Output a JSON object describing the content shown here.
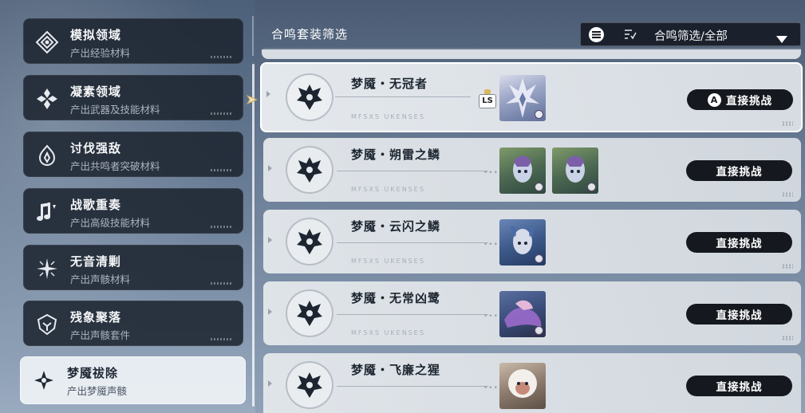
{
  "sidebar": {
    "items": [
      {
        "title": "模拟领域",
        "subtitle": "产出经验材料",
        "icon": "diamond-grid-icon",
        "active": false
      },
      {
        "title": "凝素领域",
        "subtitle": "产出武器及技能材料",
        "icon": "crystal-cluster-icon",
        "active": false
      },
      {
        "title": "讨伐强敌",
        "subtitle": "产出共鸣者突破材料",
        "icon": "flame-crest-icon",
        "active": false
      },
      {
        "title": "战歌重奏",
        "subtitle": "产出高级技能材料",
        "icon": "music-note-icon",
        "active": false
      },
      {
        "title": "无音清剿",
        "subtitle": "产出声骸材料",
        "icon": "starburst-icon",
        "active": false
      },
      {
        "title": "残象聚落",
        "subtitle": "产出声骸套件",
        "icon": "mask-crest-icon",
        "active": false
      },
      {
        "title": "梦魇祓除",
        "subtitle": "产出梦魇声骸",
        "icon": "nightmare-star-icon",
        "active": true
      }
    ]
  },
  "header": {
    "title": "合鸣套装筛选",
    "filter_label": "合鸣筛选/全部"
  },
  "rows": [
    {
      "name": "梦魇・无冠者",
      "sub": "MFSXS UKENSES",
      "button": "直接挑战",
      "button_key": "A",
      "selected": true,
      "portraits": 1,
      "ls_badge": "LS"
    },
    {
      "name": "梦魇・朔雷之鳞",
      "sub": "MFSXS UKENSES",
      "button": "直接挑战",
      "selected": false,
      "portraits": 2
    },
    {
      "name": "梦魇・云闪之鳞",
      "sub": "MFSXS UKENSES",
      "button": "直接挑战",
      "selected": false,
      "portraits": 1
    },
    {
      "name": "梦魇・无常凶鹭",
      "sub": "MFSXS UKENSES",
      "button": "直接挑战",
      "selected": false,
      "portraits": 1
    },
    {
      "name": "梦魇・飞廉之猩",
      "sub": "MFSXS UKENSES",
      "button": "直接挑战",
      "selected": false,
      "portraits": 1
    }
  ],
  "colors": {
    "panel_dark": "#1c2430",
    "row_light": "#e4e8ec",
    "button_dark": "#15191f",
    "accent_gold": "#d9b860"
  }
}
